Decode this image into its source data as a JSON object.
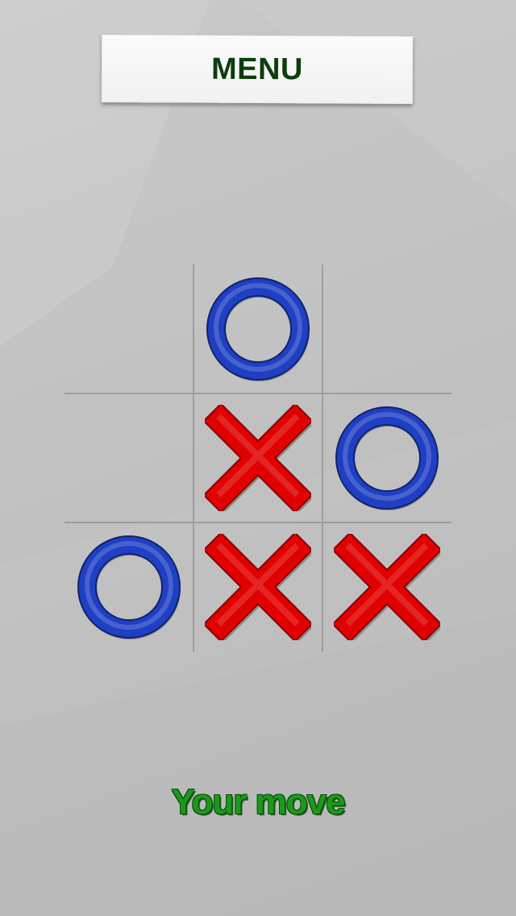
{
  "menu": {
    "label": "MENU"
  },
  "board": {
    "cells": [
      "",
      "O",
      "",
      "",
      "X",
      "O",
      "O",
      "X",
      "X"
    ]
  },
  "status": {
    "text": "Your move"
  },
  "colors": {
    "o_mark": "#1f3fc4",
    "x_mark": "#e10000",
    "status_text": "#1a9a1a",
    "menu_text": "#0c3d0c"
  }
}
